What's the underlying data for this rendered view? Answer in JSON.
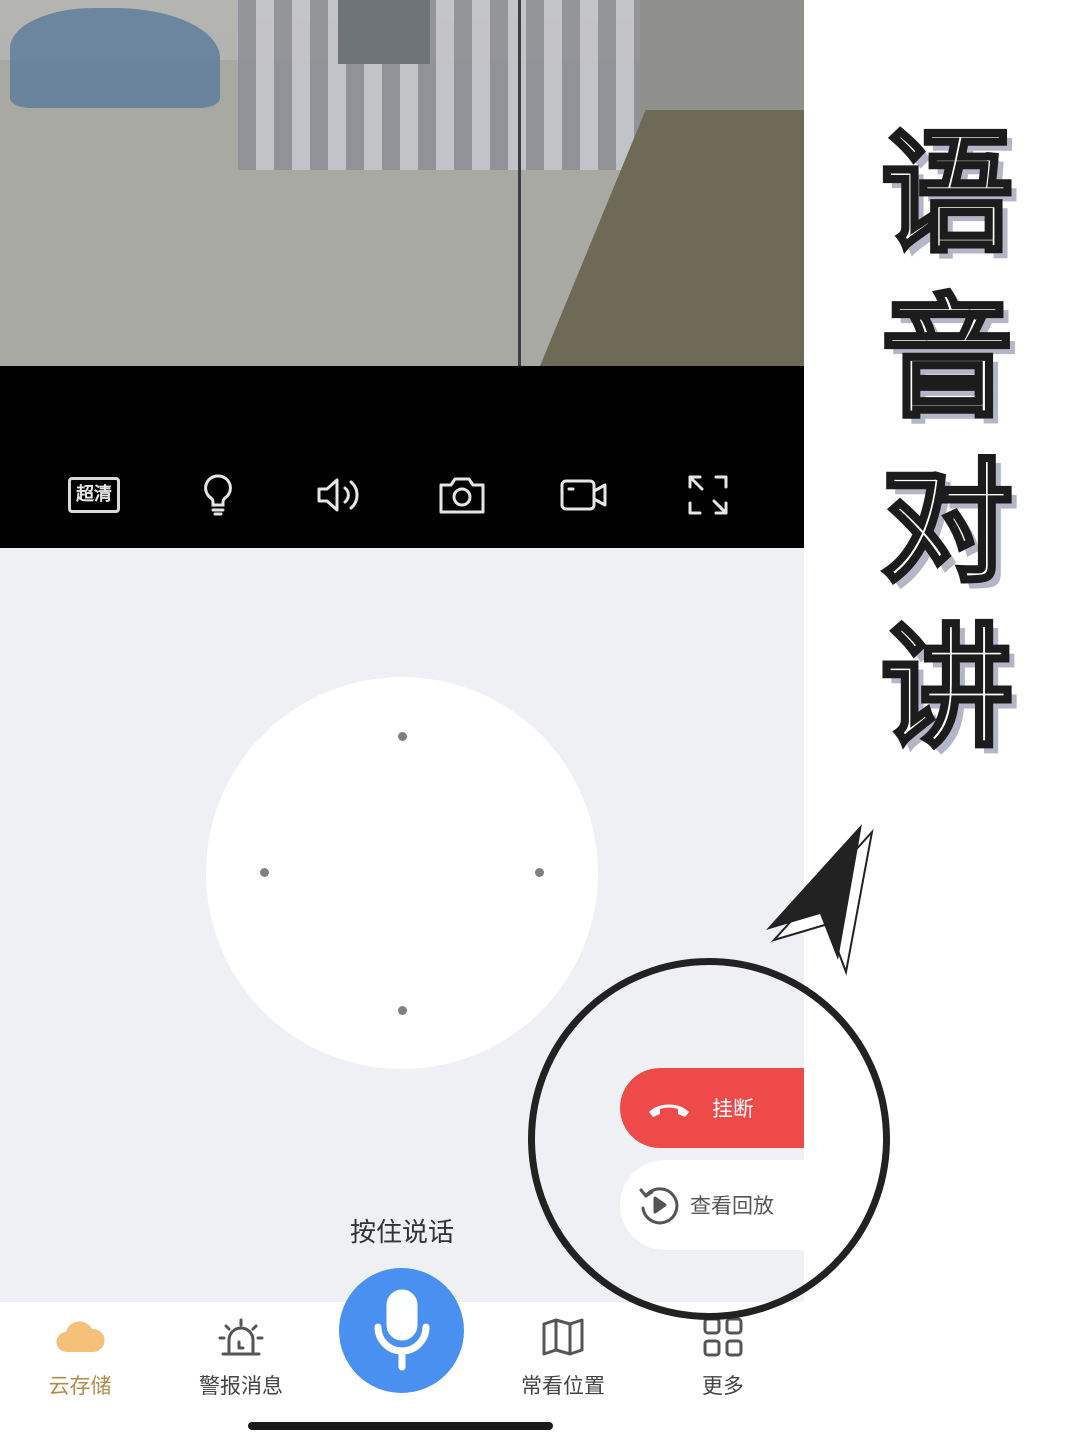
{
  "toolbar": {
    "quality_label": "超清",
    "icons": [
      "quality-badge",
      "light-bulb-icon",
      "speaker-icon",
      "camera-icon",
      "video-record-icon",
      "fullscreen-icon"
    ]
  },
  "actions": {
    "hangup_label": "挂断",
    "replay_label": "查看回放",
    "hangup_color": "#ef4a4a"
  },
  "talk": {
    "hint": "按住说话",
    "mic_color": "#4a90f0"
  },
  "tabs": [
    {
      "label": "云存储",
      "icon": "cloud-icon",
      "active": true
    },
    {
      "label": "警报消息",
      "icon": "alarm-icon",
      "active": false
    },
    {
      "label": "常看位置",
      "icon": "map-icon",
      "active": false
    },
    {
      "label": "更多",
      "icon": "grid-icon",
      "active": false
    }
  ],
  "overlay": {
    "title_chars": [
      "语",
      "音",
      "对",
      "讲"
    ]
  }
}
